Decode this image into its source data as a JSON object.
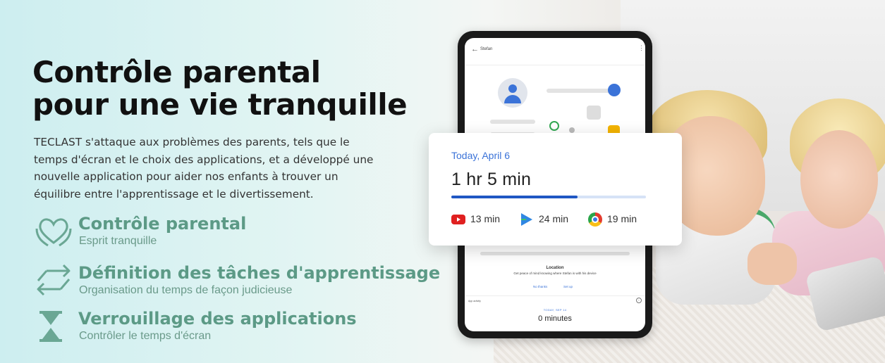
{
  "banner": {
    "title_line1": "Contrôle parental",
    "title_line2": "pour une vie tranquille",
    "description": "TECLAST s'attaque aux problèmes des parents, tels que le temps d'écran et le choix des applications, et a développé une nouvelle application pour aider nos enfants à trouver un équilibre entre l'apprentissage et le divertissement.",
    "accent_color": "#5c9a86"
  },
  "features": [
    {
      "title": "Contrôle parental",
      "subtitle": "Esprit tranquille",
      "icon": "heart-hands-icon"
    },
    {
      "title": "Définition des tâches d'apprentissage",
      "subtitle": "Organisation du temps de façon judicieuse",
      "icon": "swap-arrows-icon"
    },
    {
      "title": "Verrouillage des applications",
      "subtitle": "Contrôler le temps d'écran",
      "icon": "hourglass-icon"
    }
  ],
  "tablet": {
    "header_name": "Stefan",
    "location_title": "Location",
    "location_desc": "Get peace of mind knowing where Stefan is with his device",
    "no_thanks": "No thanks",
    "set_up": "Set up",
    "app_activity": "App activity",
    "date_small": "TODAY, SEP 14",
    "minutes": "0 minutes"
  },
  "usage_card": {
    "date": "Today, April 6",
    "total": "1 hr 5 min",
    "progress": 0.65,
    "apps": [
      {
        "name": "YouTube",
        "icon": "youtube-icon",
        "time": "13 min"
      },
      {
        "name": "Play Store",
        "icon": "play-store-icon",
        "time": "24 min"
      },
      {
        "name": "Chrome",
        "icon": "chrome-icon",
        "time": "19 min"
      }
    ]
  }
}
